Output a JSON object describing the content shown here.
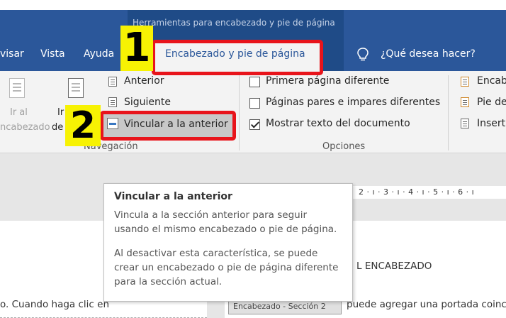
{
  "contextual_title": "Herramientas para encabezado y pie de página",
  "tabs": {
    "revisar": "visar",
    "vista": "Vista",
    "ayuda": "Ayuda",
    "active": "Encabezado y pie de página",
    "tell_me": "¿Qué desea hacer?"
  },
  "navigation": {
    "go_to_header_line1": "Ir al",
    "go_to_header_line2": "ncabezado",
    "go_to_footer_line1": "Ir",
    "go_to_footer_line2": "de",
    "previous": "Anterior",
    "next": "Siguiente",
    "link_to_previous": "Vincular a la anterior",
    "group_label": "Navegación"
  },
  "options": {
    "different_first_page": "Primera página diferente",
    "different_odd_even": "Páginas pares e impares diferentes",
    "show_document_text": "Mostrar texto del documento",
    "group_label": "Opciones",
    "different_first_page_checked": false,
    "different_odd_even_checked": false,
    "show_document_text_checked": true
  },
  "position": {
    "header_from_top": "Encab",
    "footer_from_bottom": "Pie de",
    "insert_alignment_tab": "Inserta"
  },
  "badges": {
    "step1": "1",
    "step2": "2"
  },
  "tooltip": {
    "title": "Vincular a la anterior",
    "para1": "Vincula a la sección anterior para seguir usando el mismo encabezado o pie de página.",
    "para2": "Al desactivar esta característica, se puede crear un encabezado o pie de página diferente para la sección actual."
  },
  "ruler": "2 · ı · 3 · ı · 4 · ı · 5 · ı · 6 · ı",
  "document": {
    "header_text": "L ENCABEZADO",
    "left_text": "o. Cuando haga clic en",
    "right_text": "puede agregar una portada coinc",
    "section_tag": "Encabezado - Sección 2"
  },
  "colors": {
    "ribbon_blue": "#2b579a",
    "highlight_red": "#e8141b",
    "badge_yellow": "#f7f203"
  }
}
